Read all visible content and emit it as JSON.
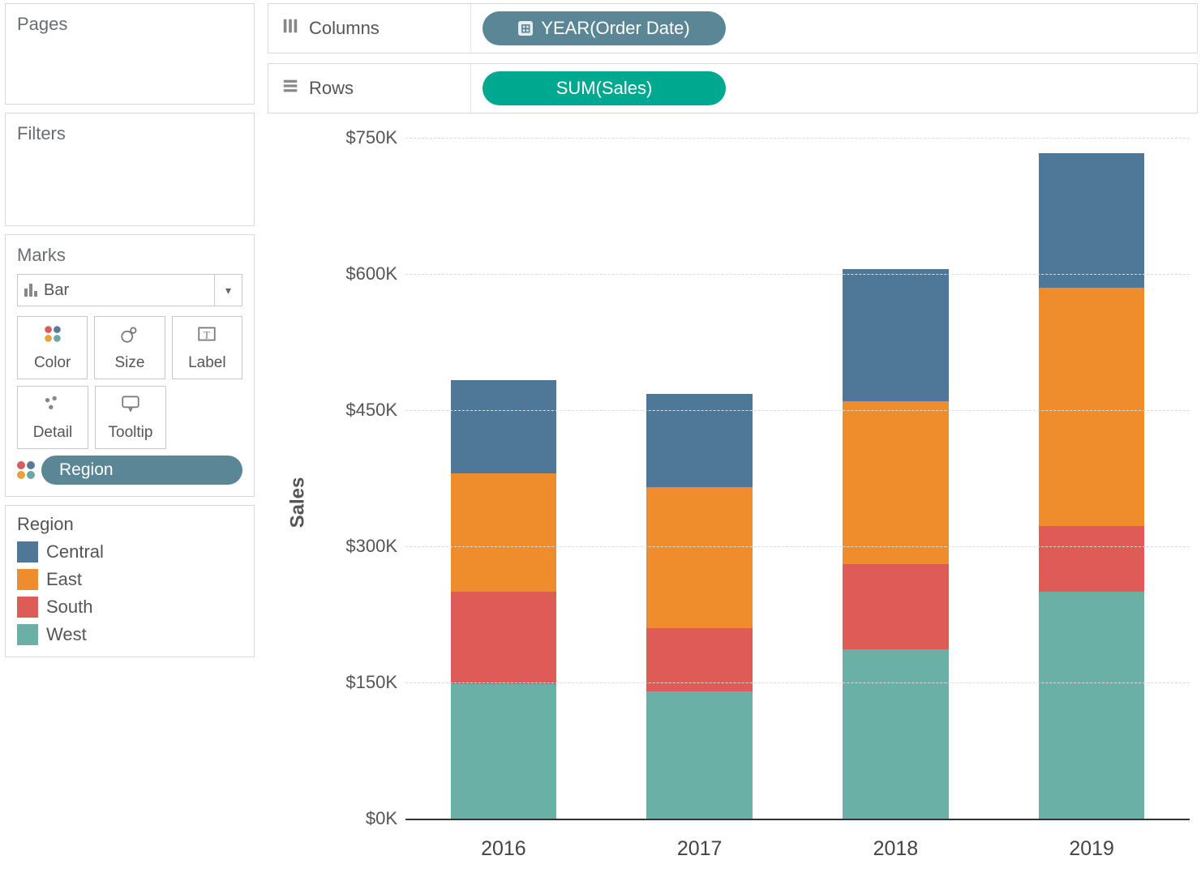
{
  "sidebar": {
    "pages_title": "Pages",
    "filters_title": "Filters",
    "marks_title": "Marks",
    "mark_type": "Bar",
    "mark_buttons": {
      "color": "Color",
      "size": "Size",
      "label": "Label",
      "detail": "Detail",
      "tooltip": "Tooltip"
    },
    "color_field_pill": "Region"
  },
  "legend": {
    "title": "Region",
    "items": [
      "Central",
      "East",
      "South",
      "West"
    ]
  },
  "colors": {
    "Central": "#4f7797",
    "East": "#ef8c2b",
    "South": "#df5b57",
    "West": "#6bb0a6"
  },
  "shelves": {
    "columns_label": "Columns",
    "columns_pill": "YEAR(Order Date)",
    "rows_label": "Rows",
    "rows_pill": "SUM(Sales)"
  },
  "chart_data": {
    "type": "bar",
    "stacked": true,
    "categories": [
      "2016",
      "2017",
      "2018",
      "2019"
    ],
    "series": [
      {
        "name": "West",
        "values": [
          148000,
          140000,
          187000,
          250000
        ]
      },
      {
        "name": "South",
        "values": [
          102000,
          70000,
          93000,
          72000
        ]
      },
      {
        "name": "East",
        "values": [
          130000,
          155000,
          180000,
          263000
        ]
      },
      {
        "name": "Central",
        "values": [
          103000,
          103000,
          145000,
          148000
        ]
      }
    ],
    "ylabel": "Sales",
    "xlabel": "",
    "ylim": [
      0,
      750000
    ],
    "yticks": [
      0,
      150000,
      300000,
      450000,
      600000,
      750000
    ],
    "ytick_labels": [
      "$0K",
      "$150K",
      "$300K",
      "$450K",
      "$600K",
      "$750K"
    ]
  }
}
